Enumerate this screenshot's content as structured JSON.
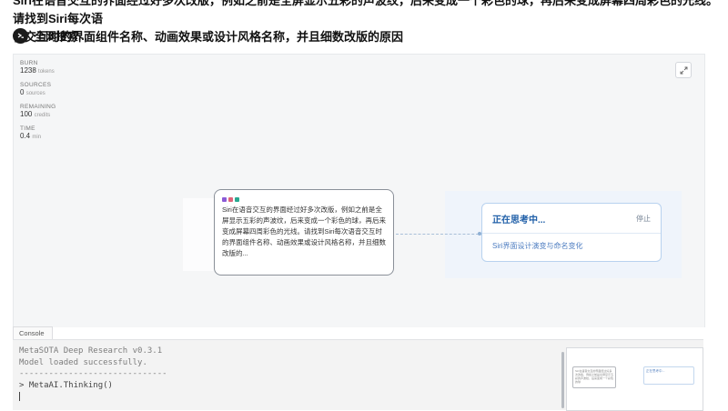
{
  "prompt": {
    "line1": "Siri在语音交互的界面经过好多次改版，例如之前是全屏显示五彩的声波纹，后来变成一个彩色的球，再后来变成屏幕四周彩色的光线。请找到Siri每次语",
    "line2": "音交互时的界面组件名称、动画效果或设计风格名称，并且细数改版的原因"
  },
  "search": {
    "icon": "search-agent-icon",
    "label": "全网搜索..."
  },
  "stats": {
    "burn_label": "BURN",
    "burn_value": "1238",
    "burn_unit": "tokens",
    "sources_label": "SOURCES",
    "sources_value": "0",
    "sources_unit": "sources",
    "remaining_label": "REMAINING",
    "remaining_value": "100",
    "remaining_unit": "credits",
    "time_label": "TIME",
    "time_value": "0.4",
    "time_unit": "min"
  },
  "expand_icon": "expand-icon",
  "source_node": {
    "text": "Siri在语音交互的界面经过好多次改版，例如之前是全屏显示五彩的声波纹，后来变成一个彩色的球，再后来变成屏幕四周彩色的光线。请找到Siri每次语音交互时的界面组件名称、动画效果或设计风格名称，并且细数改版的...",
    "dot_colors": [
      "#8b5bd6",
      "#e0637a",
      "#2aa891"
    ]
  },
  "thinking_node": {
    "title": "正在思考中...",
    "stop_label": "停止",
    "subtask": "Siri界面设计演变与命名变化"
  },
  "console": {
    "tab_label": "Console",
    "lines": [
      "MetaSOTA Deep Research v0.3.1",
      "Model loaded successfully.",
      "------------------------------",
      "> MetaAI.Thinking()"
    ]
  },
  "minimap": {
    "node1_text": "Siri在语音交互的界面经过好多次改版，例如之前是全屏显示五彩的声波纹，后来变成一个彩色的球",
    "node2_text": "正在思考中..."
  }
}
